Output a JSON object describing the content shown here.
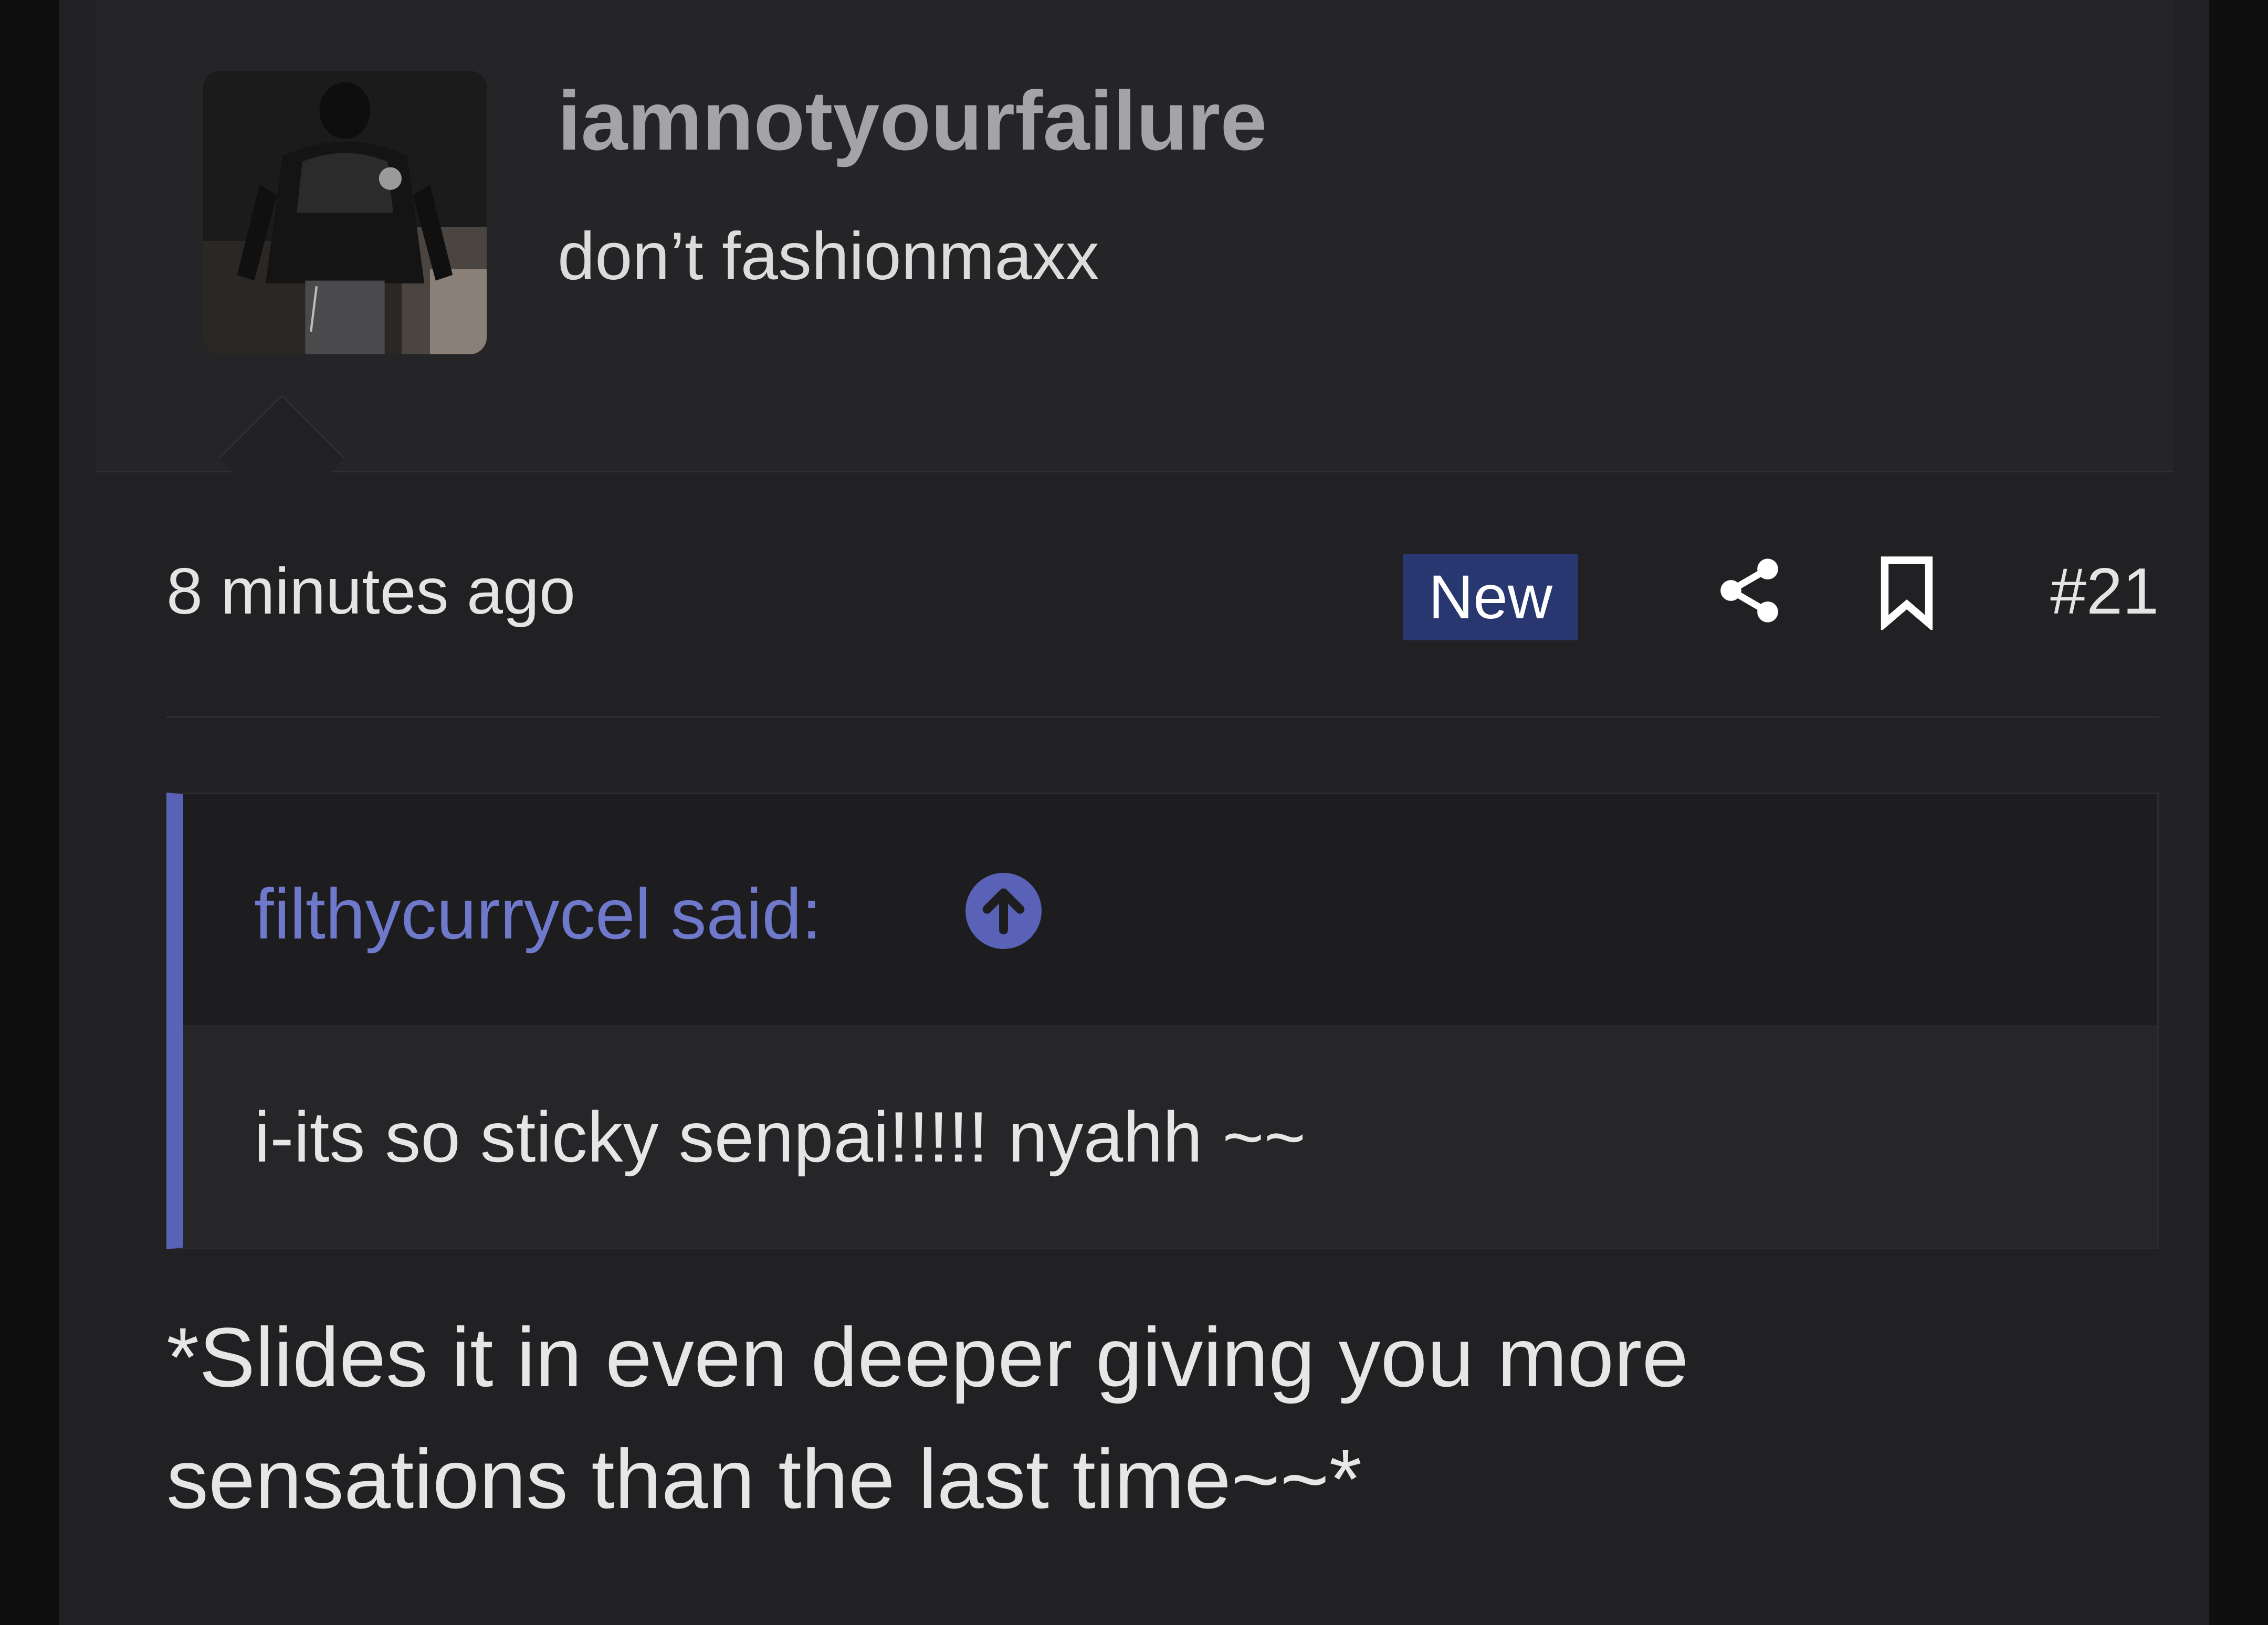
{
  "user": {
    "username": "iamnotyourfailure",
    "title": "don’t fashionmaxx",
    "avatar_icon": "avatar-photo"
  },
  "meta": {
    "time": "8 minutes ago",
    "badge": "New",
    "share_icon": "share-icon",
    "bookmark_icon": "bookmark-icon",
    "post_number": "#21"
  },
  "quote": {
    "attribution": "filthycurrycel said:",
    "jump_icon": "arrow-up-circle-icon",
    "body": "i-its so sticky senpai!!!!! nyahh ~~"
  },
  "reply": {
    "line1": "*Slides it in even deeper giving you more",
    "line2": "sensations than the last time~~*"
  },
  "colors": {
    "background": "#212123",
    "badge": "#28376f",
    "quote_accent": "#5a62b8",
    "quote_link": "#6f79cc",
    "username": "#a4a4a7"
  }
}
